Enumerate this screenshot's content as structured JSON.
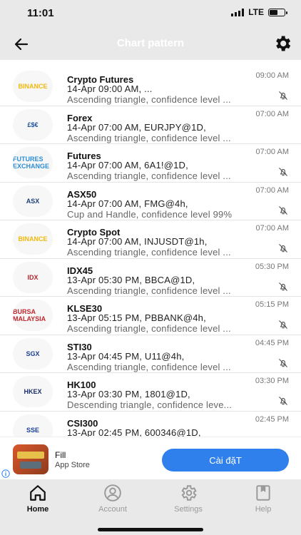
{
  "status": {
    "time": "11:01",
    "network": "LTE"
  },
  "header": {
    "title": "Chart pattern"
  },
  "alerts": [
    {
      "name": "Crypto Futures",
      "detail": "14-Apr 09:00 AM, ...",
      "pattern": "Ascending triangle, confidence level ...",
      "time": "09:00 AM",
      "logo_text": "BINANCE",
      "logo_color": "#f0b90b",
      "muted": true
    },
    {
      "name": "Forex",
      "detail": "14-Apr 07:00 AM, EURJPY@1D,",
      "pattern": "Ascending triangle, confidence level ...",
      "time": "07:00 AM",
      "logo_text": "£$€",
      "logo_color": "#1c4f9c",
      "muted": false
    },
    {
      "name": "Futures",
      "detail": "14-Apr 07:00 AM, 6A1!@1D,",
      "pattern": "Ascending triangle, confidence level ...",
      "time": "07:00 AM",
      "logo_text": "FUTURES EXCHANGE",
      "logo_color": "#2d8fd5",
      "muted": true
    },
    {
      "name": "ASX50",
      "detail": "14-Apr 07:00 AM, FMG@4h,",
      "pattern": "Cup and Handle, confidence level 99%",
      "time": "07:00 AM",
      "logo_text": "ASX",
      "logo_color": "#1d3f7a",
      "muted": true
    },
    {
      "name": "Crypto Spot",
      "detail": "14-Apr 07:00 AM, INJUSDT@1h,",
      "pattern": "Ascending triangle, confidence level ...",
      "time": "07:00 AM",
      "logo_text": "BINANCE",
      "logo_color": "#f0b90b",
      "muted": true
    },
    {
      "name": "IDX45",
      "detail": "13-Apr 05:30 PM, BBCA@1D,",
      "pattern": "Ascending triangle, confidence level ...",
      "time": "05:30 PM",
      "logo_text": "IDX",
      "logo_color": "#b3262e",
      "muted": true
    },
    {
      "name": "KLSE30",
      "detail": "13-Apr 05:15 PM, PBBANK@4h,",
      "pattern": "Ascending triangle, confidence level ...",
      "time": "05:15 PM",
      "logo_text": "BURSA MALAYSIA",
      "logo_color": "#c1272d",
      "muted": true
    },
    {
      "name": "STI30",
      "detail": "13-Apr 04:45 PM, U11@4h,",
      "pattern": "Ascending triangle, confidence level ...",
      "time": "04:45 PM",
      "logo_text": "SGX",
      "logo_color": "#1b3f94",
      "muted": true
    },
    {
      "name": "HK100",
      "detail": "13-Apr 03:30 PM, 1801@1D,",
      "pattern": "Descending triangle, confidence leve...",
      "time": "03:30 PM",
      "logo_text": "HKEX",
      "logo_color": "#1b2f6b",
      "muted": true
    },
    {
      "name": "CSI300",
      "detail": "13-Apr 02:45 PM, 600346@1D,",
      "pattern": "",
      "time": "02:45 PM",
      "logo_text": "SSE",
      "logo_color": "#1b3f94",
      "muted": false
    }
  ],
  "ad": {
    "app_name": "Fill",
    "store": "App Store",
    "cta": "Cài đặT"
  },
  "tabs": [
    {
      "label": "Home",
      "icon": "home-icon",
      "active": true
    },
    {
      "label": "Account",
      "icon": "account-icon",
      "active": false
    },
    {
      "label": "Settings",
      "icon": "gear-icon",
      "active": false
    },
    {
      "label": "Help",
      "icon": "bookmark-icon",
      "active": false
    }
  ]
}
